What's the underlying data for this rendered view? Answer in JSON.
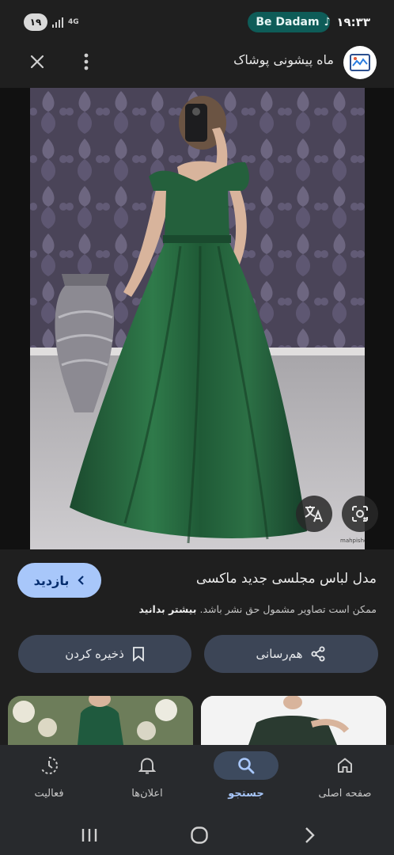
{
  "status_bar": {
    "notification_count": "۱۹",
    "network": "4G",
    "media_label": "Be Dadam",
    "time": "۱۹:۳۳"
  },
  "top_bar": {
    "site_name": "ماه پیشونی پوشاک"
  },
  "hero": {
    "watermark": "mahpishoniposhak.ir"
  },
  "result": {
    "visit_label": "بازدید",
    "title": "مدل لباس مجلسی جدید ماکسی",
    "copyright_notice": "ممکن است تصاویر مشمول حق نشر باشد.",
    "learn_more": "بیشتر بدانید"
  },
  "actions": {
    "share_label": "هم‌رسانی",
    "save_label": "ذخیره کردن"
  },
  "bottom_nav": {
    "items": [
      {
        "label": "فعالیت",
        "icon": "activity-icon"
      },
      {
        "label": "اعلان‌ها",
        "icon": "bell-icon"
      },
      {
        "label": "جستجو",
        "icon": "search-icon",
        "active": true
      },
      {
        "label": "صفحه اصلی",
        "icon": "home-icon"
      }
    ]
  },
  "colors": {
    "background": "#1f1f1f",
    "accent": "#a8c7fa",
    "media_pill": "#0e5c58",
    "action_button": "#3c4556"
  }
}
